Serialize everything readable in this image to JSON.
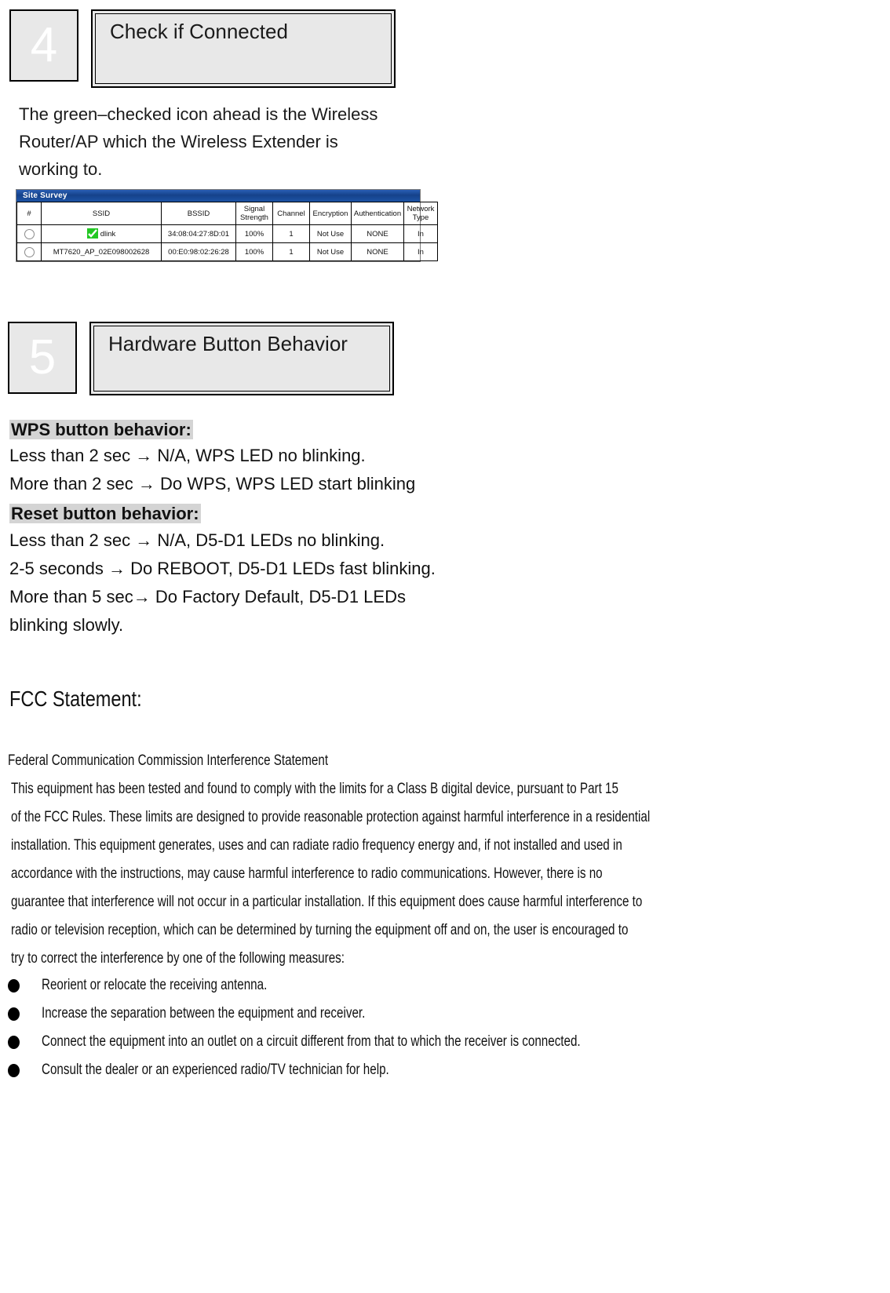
{
  "step4": {
    "number": "4",
    "title": "Check if Connected",
    "description": "The green–checked icon ahead is the Wireless Router/AP which the Wireless Extender is working to."
  },
  "site_survey": {
    "window_title": "Site Survey",
    "columns": [
      "#",
      "SSID",
      "BSSID",
      "Signal Strength",
      "Channel",
      "Encryption",
      "Authentication",
      "Network Type"
    ],
    "column_signal_line1": "Signal",
    "column_signal_line2": "Strength",
    "column_network_line1": "Network",
    "column_network_line2": "Type",
    "rows": [
      {
        "selected": "",
        "ssid": "dlink",
        "has_check_icon": true,
        "bssid": "34:08:04:27:8D:01",
        "signal_strength": "100%",
        "channel": "1",
        "encryption": "Not Use",
        "authentication": "NONE",
        "network_type": "In"
      },
      {
        "selected": "",
        "ssid": "MT7620_AP_02E098002628",
        "has_check_icon": false,
        "bssid": "00:E0:98:02:26:28",
        "signal_strength": "100%",
        "channel": "1",
        "encryption": "Not Use",
        "authentication": "NONE",
        "network_type": "In"
      }
    ]
  },
  "step5": {
    "number": "5",
    "title": "Hardware Button Behavior",
    "wps_heading": "WPS button behavior:",
    "wps_lines": [
      "Less than 2 sec  →  N/A, WPS LED no blinking.",
      "More than 2 sec  →  Do WPS, WPS LED start blinking"
    ],
    "reset_heading": "Reset button behavior:",
    "reset_lines": [
      "Less than 2 sec  →  N/A, D5-D1 LEDs no blinking.",
      "2-5 seconds  →  Do REBOOT, D5-D1 LEDs fast blinking.",
      "More than 5 sec→  Do Factory Default, D5-D1 LEDs",
      "blinking slowly."
    ]
  },
  "fcc": {
    "title": "FCC Statement:",
    "subtitle": "Federal Communication Commission Interference Statement",
    "paragraph_lines": [
      "This equipment has been tested and found to comply with the limits for a Class B digital device, pursuant to Part 15",
      "of the FCC Rules. These limits are designed to provide reasonable protection against harmful interference in a residential",
      "installation. This equipment generates, uses and can radiate radio frequency energy and, if not installed and used in",
      "accordance with the instructions, may cause harmful interference to radio communications. However, there is no",
      "guarantee that interference will not occur in a particular installation. If this equipment does cause harmful interference to",
      "radio or television reception, which can be determined by turning the equipment off and on, the user is encouraged to",
      "try to correct the interference by one of the following measures:"
    ],
    "bullets": [
      "Reorient or relocate the receiving antenna.",
      "Increase the separation between the equipment and receiver.",
      "Connect the equipment into an outlet on a circuit different from that to which the receiver is connected.",
      "Consult the dealer or an experienced radio/TV technician for help."
    ]
  }
}
